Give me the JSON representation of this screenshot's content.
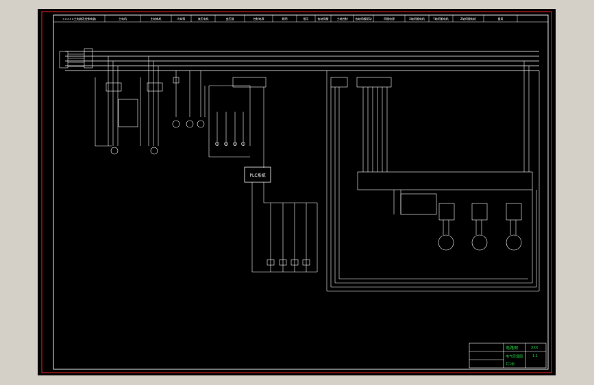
{
  "colors": {
    "background": "#000000",
    "outer_border": "#cc1f1f",
    "wire": "#ffffff",
    "label": "#22cc44",
    "app_chrome": "#d4d0c8"
  },
  "header_cells": [
    "×××××主电路及控制电路",
    "主电机",
    "主轴电机",
    "冷却泵",
    "液压电机",
    "变压器",
    "控制电源",
    "照明",
    "指示",
    "各轴伺服",
    "主轴控制",
    "各轴伺服驱动",
    "伺服电源",
    "X轴伺服电机",
    "Y轴伺服电机",
    "Z轴伺服电机",
    "备用"
  ],
  "center_box_label": "PLC系统",
  "title_block": {
    "drawing_name": "电路图",
    "sub_name": "电气原理图",
    "scale": "1:1",
    "code": "XXX",
    "sheet": "共1张"
  },
  "motor_icons": [
    "servo-motor-x-icon",
    "servo-motor-y-icon",
    "servo-motor-z-icon"
  ]
}
